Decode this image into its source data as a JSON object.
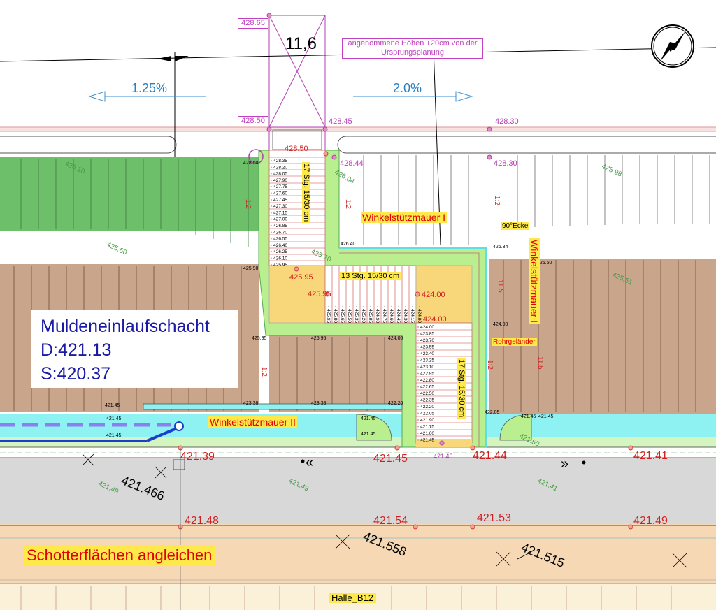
{
  "title_dimension": "11,6",
  "note": "angenommene Höhen +20cm von der Ursprungsplanung",
  "slopes": {
    "left": "1.25%",
    "right": "2.0%"
  },
  "manhole": {
    "title": "Muldeneinlaufschacht",
    "d_label": "D:421.13",
    "s_label": "S:420.37"
  },
  "walls": {
    "wall_1": "Winkelstützmauer I",
    "wall_1_vertical": "Winkelstützmauer I",
    "wall_2": "Winkelstützmauer II",
    "corner": "90°Ecke",
    "railing": "Rohrgeländer"
  },
  "stairs": {
    "upper": "17 Stg. 15/30 cm",
    "middle": "13 Stg. 15/30 cm",
    "lower": "17 Stg. 15/30 cm"
  },
  "gravel_label": "Schotterflächen angleichen",
  "hall_label": "Halle_B12",
  "magenta_heights": {
    "h428_65": "428.65",
    "h428_50_box": "428.50",
    "h428_45": "428.45",
    "h428_30_a": "428.30",
    "h428_44": "428.44",
    "h428_30_b": "428.30",
    "h421_45": "421.45"
  },
  "red_heights": {
    "h428_50": "428.50",
    "h425_95_a": "425.95",
    "h425_95_b": "425.95",
    "h424_00_a": "424.00",
    "h424_00_b": "424.00",
    "h421_39": "421.39",
    "h421_45": "421.45",
    "h421_44": "421.44",
    "h421_41": "421.41",
    "h421_48": "421.48",
    "h421_54": "421.54",
    "h421_53": "421.53",
    "h421_49": "421.49"
  },
  "black_heights": {
    "h421_466": "421.466",
    "h421_558": "421.558",
    "h421_515": "421.515"
  },
  "green_contours": {
    "c426_10": "426.10",
    "c426_04": "426.04",
    "c425_98": "425.98",
    "c425_60": "425.60",
    "c425_70": "425.70",
    "c425_61": "425.61",
    "c421_49_a": "421.49",
    "c421_49_b": "421.49",
    "c421_41": "421.41",
    "c421_50": "421.50"
  },
  "slope_ratio": "1:2",
  "slope_11_5": "11.5",
  "upper_steps": [
    "428.35",
    "428.20",
    "428.05",
    "427.90",
    "427.75",
    "427.60",
    "427.45",
    "427.30",
    "427.15",
    "427.00",
    "426.85",
    "426.70",
    "426.55",
    "426.40",
    "426.25",
    "426.10",
    "425.95"
  ],
  "middle_steps": [
    "425.95",
    "425.80",
    "425.65",
    "425.50",
    "425.35",
    "425.20",
    "425.05",
    "424.90",
    "424.75",
    "424.60",
    "424.45",
    "424.30",
    "424.15",
    "424.00"
  ],
  "lower_steps": [
    "424.00",
    "423.85",
    "423.70",
    "423.55",
    "423.40",
    "423.25",
    "423.10",
    "422.95",
    "422.80",
    "422.65",
    "422.50",
    "422.35",
    "422.20",
    "422.05",
    "421.90",
    "421.75",
    "421.60",
    "421.45"
  ],
  "small_heights": {
    "s428_50": "428.50",
    "s426_40": "426.40",
    "s426_34": "426.34",
    "s425_60": "425.60",
    "s425_98": "425.98",
    "s425_95_a": "425.95",
    "s425_95_b": "425.95",
    "s424_00_a": "424.00",
    "s424_00_b": "424.00",
    "s423_38_a": "423.38",
    "s423_38_b": "423.38",
    "s422_20": "422.20",
    "s422_05": "422.05",
    "s421_45_a": "421.45",
    "s421_45_b": "421.45",
    "s421_45_c": "421.45",
    "s421_45_d": "421.45",
    "s421_45_e": "421.45",
    "s421_45_f": "421.45",
    "s421_45_g": "421.45"
  }
}
